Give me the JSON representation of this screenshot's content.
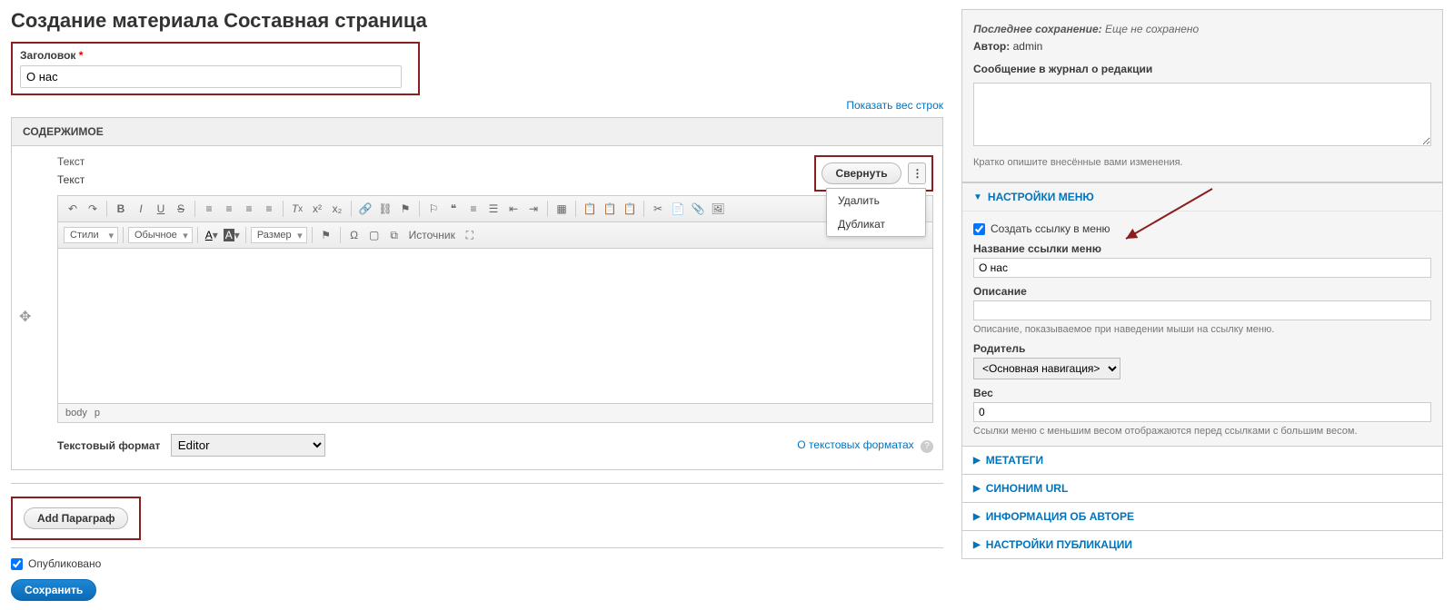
{
  "page_title": "Создание материала Составная страница",
  "title_field": {
    "label": "Заголовок",
    "value": "О нас"
  },
  "show_weights_link": "Показать вес строк",
  "content_section": "СОДЕРЖИМОЕ",
  "paragraph": {
    "type_label": "Текст",
    "field_label": "Текст",
    "collapse_btn": "Свернуть",
    "menu_delete": "Удалить",
    "menu_duplicate": "Дубликат"
  },
  "cke": {
    "styles": "Стили",
    "format": "Обычное",
    "size": "Размер",
    "source": "Источник",
    "path_body": "body",
    "path_p": "p"
  },
  "text_format": {
    "label": "Текстовый формат",
    "value": "Editor",
    "help": "О текстовых форматах"
  },
  "add_paragraph_btn": "Add Параграф",
  "published_label": "Опубликовано",
  "save_btn": "Сохранить",
  "sidebar": {
    "last_saved_label": "Последнее сохранение:",
    "last_saved_value": "Еще не сохранено",
    "author_label": "Автор:",
    "author_value": "admin",
    "log_label": "Сообщение в журнал о редакции",
    "log_helper": "Кратко опишите внесённые вами изменения.",
    "menu_settings": "НАСТРОЙКИ МЕНЮ",
    "menu_create_link": "Создать ссылку в меню",
    "menu_link_name_label": "Название ссылки меню",
    "menu_link_name_value": "О нас",
    "description_label": "Описание",
    "description_helper": "Описание, показываемое при наведении мыши на ссылку меню.",
    "parent_label": "Родитель",
    "parent_value": "<Основная навигация>",
    "weight_label": "Вес",
    "weight_value": "0",
    "weight_helper": "Ссылки меню с меньшим весом отображаются перед ссылками с большим весом.",
    "tab_metatags": "МЕТАТЕГИ",
    "tab_url_alias": "СИНОНИМ URL",
    "tab_author_info": "ИНФОРМАЦИЯ ОБ АВТОРЕ",
    "tab_publish_settings": "НАСТРОЙКИ ПУБЛИКАЦИИ"
  }
}
